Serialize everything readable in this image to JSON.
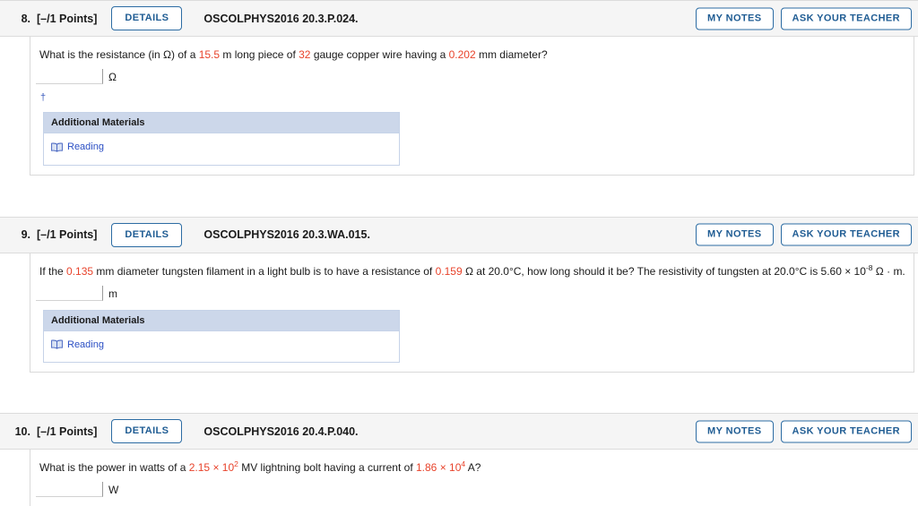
{
  "theme": {
    "accent_blue": "#1f5c93",
    "value_red": "#e8432b",
    "link_blue": "#2b4fc4",
    "header_bg": "#f5f5f5",
    "materials_header_bg": "#ccd7ea"
  },
  "common": {
    "details_label": "DETAILS",
    "my_notes_label": "MY NOTES",
    "ask_teacher_label": "ASK YOUR TEACHER",
    "additional_materials_label": "Additional Materials",
    "reading_label": "Reading",
    "book_icon": "book-icon",
    "dagger": "†",
    "answer_placeholder": ""
  },
  "questions": [
    {
      "number": "8.",
      "points": "[–/1 Points]",
      "code": "OSCOLPHYS2016 20.3.P.024.",
      "prompt": {
        "p1": "What is the resistance (in Ω) of a ",
        "v1": "15.5",
        "p2": " m long piece of ",
        "v2": "32",
        "p3": " gauge copper wire having a ",
        "v3": "0.202",
        "p4": " mm diameter?"
      },
      "answer_value": "",
      "unit": "Ω",
      "has_dagger": true,
      "has_materials": true,
      "boxed": true
    },
    {
      "number": "9.",
      "points": "[–/1 Points]",
      "code": "OSCOLPHYS2016 20.3.WA.015.",
      "prompt": {
        "p1": "If the ",
        "v1": "0.135",
        "p2": " mm diameter tungsten filament in a light bulb is to have a resistance of ",
        "v2": "0.159",
        "p3": " Ω at 20.0°C, how long should it be? The resistivity of tungsten at 20.0°C is 5.60 × 10",
        "exp3": "-8",
        "p4": " Ω · m."
      },
      "answer_value": "",
      "unit": "m",
      "has_dagger": false,
      "has_materials": true,
      "boxed": true
    },
    {
      "number": "10.",
      "points": "[–/1 Points]",
      "code": "OSCOLPHYS2016 20.4.P.040.",
      "prompt": {
        "p1": "What is the power in watts of a ",
        "v1": "2.15 × 10",
        "exp1": "2",
        "p2": " MV lightning bolt having a current of ",
        "v2": "1.86 × 10",
        "exp2": "4",
        "p3": " A?"
      },
      "answer_value": "",
      "unit": "W",
      "has_dagger": false,
      "has_materials": false,
      "boxed": false
    }
  ]
}
